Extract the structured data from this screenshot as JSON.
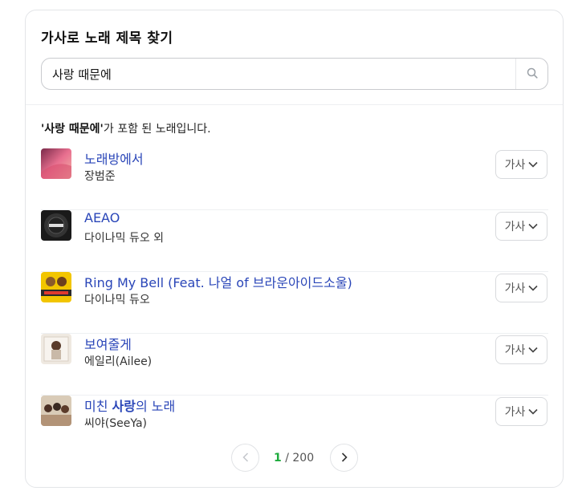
{
  "header": {
    "title": "가사로 노래 제목 찾기"
  },
  "search": {
    "value": "사랑 때문에",
    "placeholder": ""
  },
  "summary": {
    "query": "'사랑 때문에'",
    "suffix": "가 포함 된 노래입니다."
  },
  "results": [
    {
      "title": "노래방에서",
      "title_pre": "노래방에서",
      "title_bold": "",
      "title_post": "",
      "artist": "장범준",
      "button_label": "가사"
    },
    {
      "title": "AEAO",
      "title_pre": "AEAO",
      "title_bold": "",
      "title_post": "",
      "artist": "다이나믹 듀오 외",
      "button_label": "가사"
    },
    {
      "title": "Ring My Bell (Feat. 나얼 of 브라운아이드소울)",
      "title_pre": "Ring My Bell (Feat. 나얼 of 브라운아이드소울)",
      "title_bold": "",
      "title_post": "",
      "artist": "다이나믹 듀오",
      "button_label": "가사"
    },
    {
      "title": "보여줄게",
      "title_pre": "보여줄게",
      "title_bold": "",
      "title_post": "",
      "artist": "에일리(Ailee)",
      "button_label": "가사"
    },
    {
      "title": "미친 사랑의 노래",
      "title_pre": "미친 ",
      "title_bold": "사랑",
      "title_post": "의 노래",
      "artist": "씨야(SeeYa)",
      "button_label": "가사"
    }
  ],
  "pagination": {
    "current": "1",
    "separator": " / ",
    "total": "200"
  },
  "colors": {
    "link": "#2a46b8",
    "current_page": "#1eab3d",
    "border": "#e3e5e8"
  },
  "icons": {
    "search": "search-icon",
    "chevron": "chevron-down-icon",
    "prev": "chevron-left-icon",
    "next": "chevron-right-icon"
  }
}
